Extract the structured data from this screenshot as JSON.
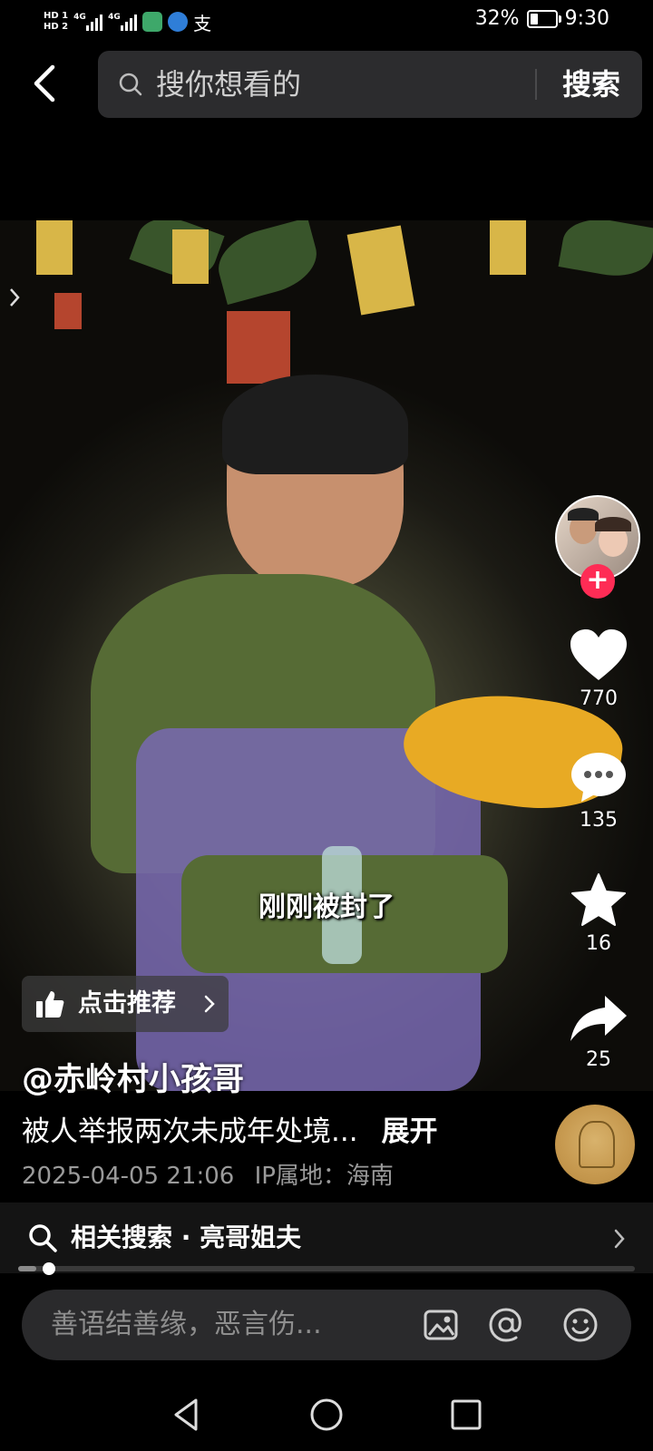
{
  "status_bar": {
    "hd1": "HD 1",
    "hd2": "HD 2",
    "net1": "4G",
    "net2": "4G",
    "battery_text": "32%",
    "battery_level": 0.32,
    "time": "9:30",
    "alipay_glyph": "支"
  },
  "search": {
    "placeholder": "搜你想看的",
    "button_label": "搜索"
  },
  "video": {
    "subtitle": "刚刚被封了"
  },
  "actions": {
    "likes": "770",
    "comments": "135",
    "favorites": "16",
    "shares": "25"
  },
  "recommend": {
    "label": "点击推荐"
  },
  "post": {
    "author": "@赤岭村小孩哥",
    "description": "被人举报两次未成年处境...",
    "expand_label": "展开",
    "date": "2025-04-05 21:06",
    "ip_location": "IP属地：海南"
  },
  "related": {
    "label": "相关搜索 · 亮哥姐夫"
  },
  "playback": {
    "progress": 0.03
  },
  "comment": {
    "placeholder": "善语结善缘，恶言伤..."
  },
  "icons": {
    "back": "chevron-left-icon",
    "search": "search-icon",
    "like": "heart-icon",
    "comment": "comment-bubble-icon",
    "favorite": "star-icon",
    "share": "share-arrow-icon",
    "thumb": "thumbs-up-icon",
    "image": "image-icon",
    "at": "at-sign-icon",
    "emoji": "smiley-icon",
    "nav_back": "triangle-back-icon",
    "nav_home": "circle-home-icon",
    "nav_recent": "square-recent-icon"
  },
  "colors": {
    "follow": "#fe2c55",
    "search_bg": "#2c2c2e",
    "comment_bg": "#2a2a2c"
  }
}
